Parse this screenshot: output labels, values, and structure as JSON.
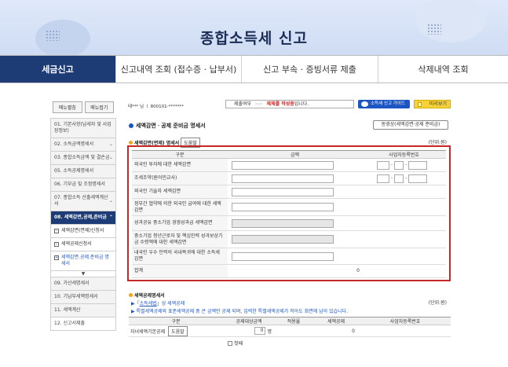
{
  "app": {
    "title": "종합소득세 신고"
  },
  "tabs": [
    {
      "label": "세금신고",
      "active": true
    },
    {
      "label": "신고내역 조회 (접수증 · 납부서)",
      "active": false
    },
    {
      "label": "신고 부속 · 증빙서류 제출",
      "active": false
    },
    {
      "label": "삭제내역 조회",
      "active": false
    }
  ],
  "sidebar": {
    "expand": "메뉴펼침",
    "collapse": "메뉴접기",
    "items": [
      {
        "label": "01. 기본사항(납세자 및 사업장정보)"
      },
      {
        "label": "02. 소득금액명세서"
      },
      {
        "label": "03. 종합소득금액 및 결손금"
      },
      {
        "label": "05. 소득공제명세서"
      },
      {
        "label": "06. 기부금 및 조정명세서"
      },
      {
        "label": "07. 종합소득 산출세액계산서"
      },
      {
        "label": "08. 세액감면,공제,준비금"
      }
    ],
    "subitems": [
      {
        "label": "세액감면(면제)신청서",
        "mark": "–"
      },
      {
        "label": "세액공제신청서",
        "mark": "–"
      },
      {
        "label": "세액감면.공제.준비금 명세서",
        "mark": "+"
      }
    ],
    "items_after": [
      {
        "label": "09. 가산세명세서"
      },
      {
        "label": "10. 기납부세액명세서"
      },
      {
        "label": "11. 세액계산"
      },
      {
        "label": "12. 신고서제출"
      }
    ]
  },
  "header": {
    "user": "테*** 님 ㅣ 800101-*******",
    "status_label": "제출여부",
    "status_arrows": "››››",
    "status_red": "제체를 작성중",
    "status_tail": "입니다.",
    "video_btn": "소득세 신고 가이드",
    "preview_btn": "미리보기"
  },
  "section": {
    "title": "세액감면ㆍ공제 준비금 명세서",
    "flow_btn": "동영상(세액감면·공제 준비금)",
    "sub_title": "세액감면(면제) 명세서",
    "help_btn": "도움말",
    "unit": "(단위:원)"
  },
  "table": {
    "headers": [
      "구분",
      "금액",
      "사업자등록번호"
    ],
    "rows": [
      {
        "label": "외국인 투자에 대한 세액감면",
        "gray": false,
        "biz": true
      },
      {
        "label": "조세조약(원어민교사)",
        "gray": false,
        "biz": true
      },
      {
        "label": "외국인 기술자 세액감면",
        "gray": false,
        "biz": false
      },
      {
        "label": "정부간 협약에 의한 외국인 급여에 대한 세액감면",
        "gray": false,
        "biz": false
      },
      {
        "label": "성과공유 중소기업 경영성과급 세액감면",
        "gray": true,
        "biz": false
      },
      {
        "label": "중소기업 청년근로자 및 핵심인력 성과보상기금 수령액에 대한 세액감면",
        "gray": true,
        "biz": false
      },
      {
        "label": "내국인 우수 인력의 국내복귀에 대한 소득세 감면",
        "gray": false,
        "biz": false
      }
    ],
    "total_label": "합계",
    "total_value": "0"
  },
  "section2": {
    "title": "세액공제명세서",
    "line1_prefix": "▶「",
    "line1_link": "소득세법",
    "line1_suffix": "」상 세액공제",
    "line2": "▶ 특별세액공제와 표준세액공제 중 큰 금액만 공제 되며, 입력한 특별세액공제가 작아도 화면에 남아 있습니다.",
    "unit": "(단위:원)",
    "headers": [
      "구분",
      "공제대상금액",
      "적용율",
      "세액공제",
      "사업자등록번호"
    ],
    "row_label": "자녀세액기본공제",
    "row_help": "도움말",
    "row_value": "0",
    "row_unit": "명",
    "row_credit": "0",
    "check_label": "첫째"
  }
}
